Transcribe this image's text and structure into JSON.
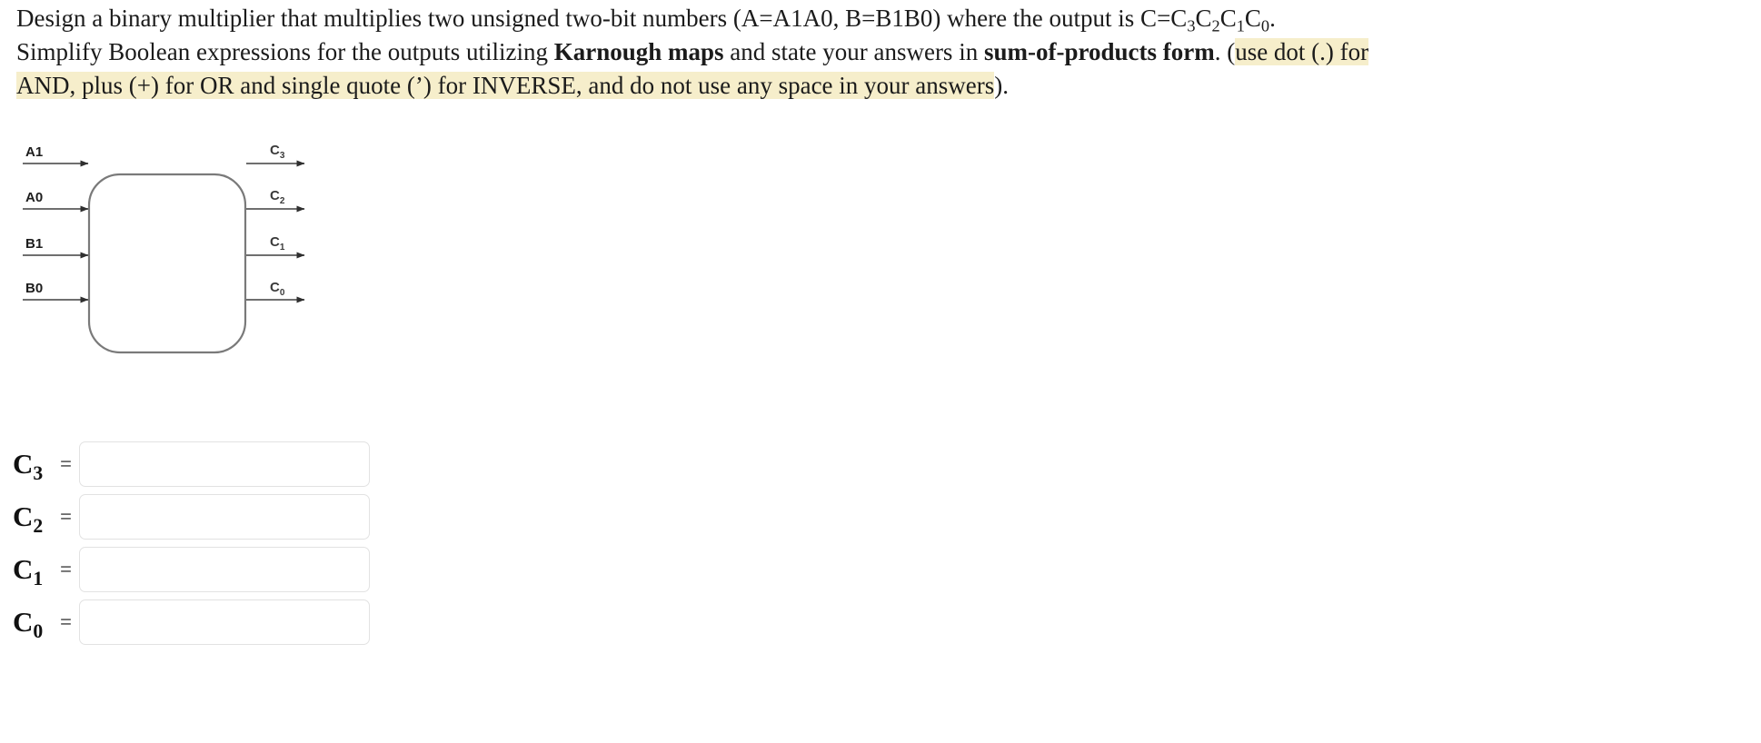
{
  "prompt": {
    "line1_a": "Design a binary multiplier that multiplies two unsigned two-bit numbers (A=A1A0, B=B1B0) where the output is C=C",
    "line1_sub3": "3",
    "line1_b": "C",
    "line1_sub2": "2",
    "line1_c": "C",
    "line1_sub1": "1",
    "line1_d": "C",
    "line1_sub0": "0",
    "line1_e": ".",
    "line2_a": "Simplify Boolean expressions for the outputs utilizing ",
    "line2_bold1": "Karnough maps",
    "line2_b": " and state your answers in ",
    "line2_bold2": "sum-of-products form",
    "line2_c": ". (",
    "line2_hl": "use dot (.) for",
    "line3_hl": "AND, plus (+) for OR and single quote (’) for INVERSE, and do not use any space in your answers",
    "line3_tail": ")."
  },
  "diagram": {
    "inputs": [
      {
        "label": "A1"
      },
      {
        "label": "A0"
      },
      {
        "label": "B1"
      },
      {
        "label": "B0"
      }
    ],
    "outputs": [
      {
        "base": "C",
        "sub": "3"
      },
      {
        "base": "C",
        "sub": "2"
      },
      {
        "base": "C",
        "sub": "1"
      },
      {
        "base": "C",
        "sub": "0"
      }
    ],
    "box_label": "",
    "stroke_color": "#6b6b6b",
    "arrow_color": "#3c3c3c"
  },
  "answers": {
    "rows": [
      {
        "base": "C",
        "sub": "3",
        "equals": "=",
        "value": "",
        "placeholder": ""
      },
      {
        "base": "C",
        "sub": "2",
        "equals": "=",
        "value": "",
        "placeholder": ""
      },
      {
        "base": "C",
        "sub": "1",
        "equals": "=",
        "value": "",
        "placeholder": ""
      },
      {
        "base": "C",
        "sub": "0",
        "equals": "=",
        "value": "",
        "placeholder": ""
      }
    ]
  },
  "colors": {
    "highlight": "#f6eecb",
    "input_border": "#e2e2e2",
    "text": "#1b1b1b"
  }
}
